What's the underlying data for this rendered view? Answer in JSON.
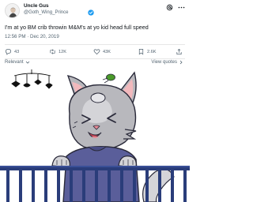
{
  "author": {
    "display_name": "Uncle Gus",
    "handle": "@Goth_Wing_Prince",
    "verified_color": "#1d9bf0"
  },
  "header_icons": [
    "threads-icon",
    "more-icon"
  ],
  "tweet": {
    "text": "I'm at yo BM crib throwin M&M's at yo kid head full speed",
    "timestamp": "12:56 PM · Dec 20, 2019"
  },
  "actions": {
    "replies": "43",
    "retweets": "12K",
    "likes": "43K",
    "bookmarks": "2.6K"
  },
  "sort": {
    "label": "Relevant"
  },
  "quotes": {
    "label": "View quotes"
  },
  "colors": {
    "text": "#0f1419",
    "secondary": "#536471",
    "divider": "#e7e7e7",
    "cat_gray": "#b8b8bd",
    "shirt": "#5a5e9a",
    "mm_green": "#4a9a2a",
    "crib_blue": "#2a3d7a"
  }
}
